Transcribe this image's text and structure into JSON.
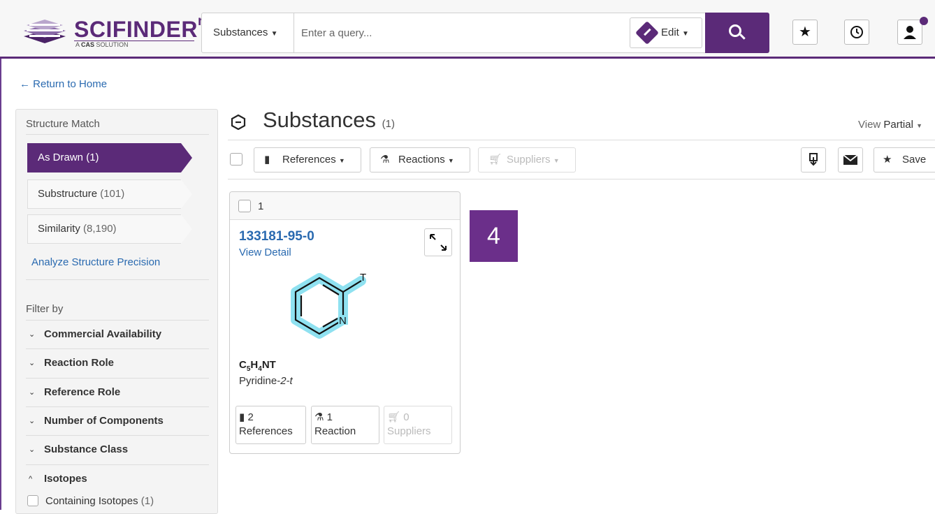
{
  "header": {
    "logo_text": "SCIFINDER",
    "logo_sup": "n",
    "logo_sub_prefix": "A ",
    "logo_sub_bold": "CAS",
    "logo_sub_suffix": " SOLUTION",
    "search_type": "Substances",
    "search_placeholder": "Enter a query...",
    "edit_label": "Edit",
    "accent_color": "#5b2a78"
  },
  "return_link": "← Return to Home",
  "sidebar": {
    "structure_match_title": "Structure Match",
    "match_items": [
      {
        "label": "As Drawn",
        "count": "(1)",
        "active": true
      },
      {
        "label": "Substructure",
        "count": "(101)",
        "active": false
      },
      {
        "label": "Similarity",
        "count": "(8,190)",
        "active": false
      }
    ],
    "analyze_link": "Analyze Structure Precision",
    "filter_title": "Filter by",
    "filters": [
      {
        "label": "Commercial Availability",
        "chev": "⌄"
      },
      {
        "label": "Reaction Role",
        "chev": "⌄"
      },
      {
        "label": "Reference Role",
        "chev": "⌄"
      },
      {
        "label": "Number of Components",
        "chev": "⌄"
      },
      {
        "label": "Substance Class",
        "chev": "⌄"
      },
      {
        "label": "Isotopes",
        "chev": "^"
      }
    ],
    "isotope_option": {
      "label": "Containing Isotopes",
      "count": "(1)"
    }
  },
  "main": {
    "title": "Substances",
    "count": "(1)",
    "view_label": "View",
    "view_value": "Partial",
    "toolbar": {
      "references": "References",
      "reactions": "Reactions",
      "suppliers": "Suppliers",
      "save": "Save"
    }
  },
  "card": {
    "number": "1",
    "cas_rn": "133181-95-0",
    "view_detail": "View Detail",
    "formula_parts": [
      "C",
      "5",
      "H",
      "4",
      "NT"
    ],
    "name_prefix": "Pyridine-",
    "name_italic": "2-t",
    "atom_labels": {
      "t": "T",
      "n": "N"
    },
    "stats": [
      {
        "count": "2",
        "label": "References"
      },
      {
        "count": "1",
        "label": "Reaction"
      },
      {
        "count": "0",
        "label": "Suppliers"
      }
    ]
  },
  "badge": "4"
}
